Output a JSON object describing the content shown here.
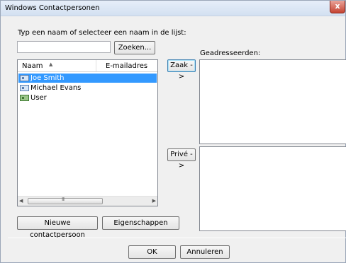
{
  "window": {
    "title": "Windows Contactpersonen",
    "close_glyph": "x"
  },
  "search": {
    "prompt": "Typ een naam of selecteer een naam in de lijst:",
    "input_value": "",
    "button_label": "Zoeken..."
  },
  "contacts_list": {
    "columns": [
      "Naam",
      "E-mailadres"
    ],
    "sort_icon": "sort-ascending-icon",
    "rows": [
      {
        "name": "Joe Smith",
        "email": "",
        "icon": "contact-card-icon",
        "selected": true
      },
      {
        "name": "Michael Evans",
        "email": "",
        "icon": "contact-card-icon",
        "selected": false
      },
      {
        "name": "User",
        "email": "",
        "icon": "user-contact-icon",
        "selected": false
      }
    ],
    "scroll_grip": "III"
  },
  "recipients": {
    "label": "Geadresseerden:",
    "zaak_button": "Zaak ->",
    "prive_button": "Privé ->"
  },
  "actions": {
    "new_contact": "Nieuwe contactpersoon",
    "properties": "Eigenschappen",
    "ok": "OK",
    "cancel": "Annuleren"
  },
  "colors": {
    "selection": "#3399ff",
    "close_button": "#c64432",
    "titlebar": "#d3e0f1"
  }
}
